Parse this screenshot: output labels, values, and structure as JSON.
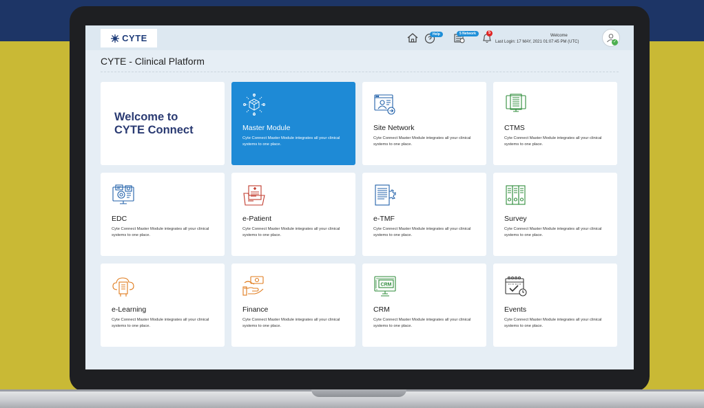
{
  "app": {
    "logo_text": "CYTE",
    "page_title": "CYTE - Clinical Platform"
  },
  "header": {
    "help_label": "Help",
    "network_label": "5 Network",
    "notification_count": "5",
    "welcome_label": "Welcome",
    "last_login": "Last Login: 17 MAY, 2021 01:07:45 PM (UTC)"
  },
  "welcome_card": {
    "line1": "Welcome to",
    "line2": "CYTE Connect"
  },
  "modules": [
    {
      "name": "Master Module",
      "desc": "Cyte Connect Master Module integrates all your clinical systems to one place.",
      "icon": "cube-network-icon",
      "active": true
    },
    {
      "name": "Site Network",
      "desc": "Cyte Connect Master Module integrates all your clinical systems to one place.",
      "icon": "site-network-icon"
    },
    {
      "name": "CTMS",
      "desc": "Cyte Connect Master Module integrates all your clinical systems to one place.",
      "icon": "ctms-monitor-icon"
    },
    {
      "name": "EDC",
      "desc": "Cyte Connect Master Module integrates all your clinical systems to one place.",
      "icon": "edc-screen-icon"
    },
    {
      "name": "e-Patient",
      "desc": "Cyte Connect Master Module integrates all your clinical systems to one place.",
      "icon": "patient-folder-icon"
    },
    {
      "name": "e-TMF",
      "desc": "Cyte Connect Master Module integrates all your clinical systems to one place.",
      "icon": "document-gear-icon"
    },
    {
      "name": "Survey",
      "desc": "Cyte Connect Master Module integrates all your clinical systems to one place.",
      "icon": "binders-icon"
    },
    {
      "name": "e-Learning",
      "desc": "Cyte Connect Master Module integrates all your clinical systems to one place.",
      "icon": "cloud-book-icon"
    },
    {
      "name": "Finance",
      "desc": "Cyte Connect Master Module integrates all your clinical systems to one place.",
      "icon": "hand-money-icon"
    },
    {
      "name": "CRM",
      "desc": "Cyte Connect Master Module integrates all your clinical systems to one place.",
      "icon": "crm-monitor-icon"
    },
    {
      "name": "Events",
      "desc": "Cyte Connect Master Module integrates all your clinical systems to one place.",
      "icon": "calendar-check-icon"
    }
  ],
  "colors": {
    "accent_blue": "#1e8ad6",
    "icon_blue": "#1f5fa8",
    "icon_green": "#2e8b3a",
    "icon_red": "#c0392b",
    "icon_orange": "#e07b1c",
    "navy": "#2a3a72"
  }
}
